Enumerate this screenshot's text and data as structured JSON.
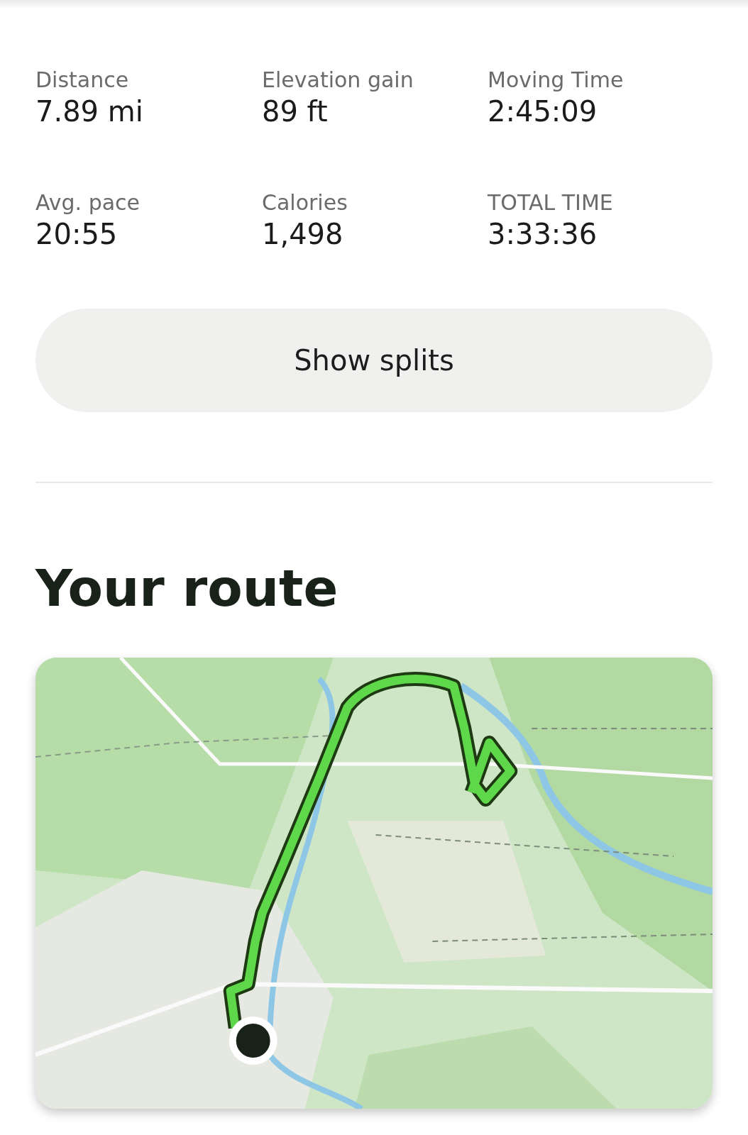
{
  "stats": [
    {
      "label": "Distance",
      "value": "7.89 mi"
    },
    {
      "label": "Elevation gain",
      "value": "89 ft"
    },
    {
      "label": "Moving Time",
      "value": "2:45:09"
    },
    {
      "label": "Avg. pace",
      "value": "20:55"
    },
    {
      "label": "Calories",
      "value": "1,498"
    },
    {
      "label": "TOTAL TIME",
      "value": "3:33:36"
    }
  ],
  "splits_button": {
    "label": "Show splits"
  },
  "route": {
    "title": "Your route"
  }
}
